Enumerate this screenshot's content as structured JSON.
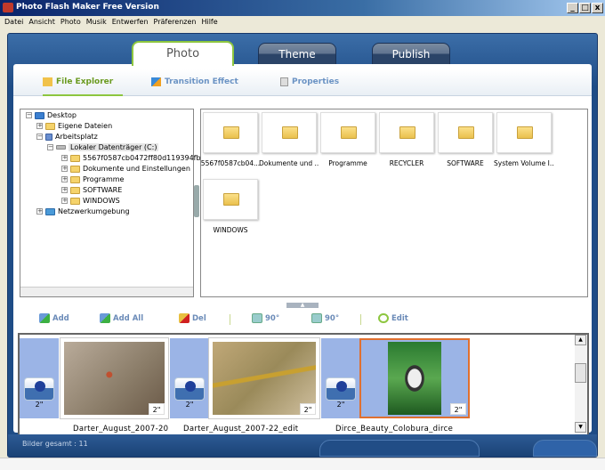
{
  "window": {
    "title": "Photo Flash Maker Free Version",
    "minimize": "_",
    "maximize": "□",
    "close": "x"
  },
  "menu": [
    "Datei",
    "Ansicht",
    "Photo",
    "Musik",
    "Entwerfen",
    "Präferenzen",
    "Hilfe"
  ],
  "main_tabs": [
    "Photo",
    "Theme",
    "Publish"
  ],
  "sub_tabs": [
    "File Explorer",
    "Transition Effect",
    "Properties"
  ],
  "tree": [
    {
      "label": "Desktop",
      "expander": "−"
    },
    {
      "label": "Eigene Dateien",
      "expander": "+"
    },
    {
      "label": "Arbeitsplatz",
      "expander": "−"
    },
    {
      "label": "Lokaler Datenträger (C:)",
      "expander": "−"
    },
    {
      "label": "5567f0587cb0472ff80d119394fb",
      "expander": "+"
    },
    {
      "label": "Dokumente und Einstellungen",
      "expander": "+"
    },
    {
      "label": "Programme",
      "expander": "+"
    },
    {
      "label": "SOFTWARE",
      "expander": "+"
    },
    {
      "label": "WINDOWS",
      "expander": "+"
    },
    {
      "label": "Netzwerkumgebung",
      "expander": "+"
    }
  ],
  "folders": [
    "5567f0587cb04...",
    "Dokumente und ...",
    "Programme",
    "RECYCLER",
    "SOFTWARE",
    "System Volume I...",
    "WINDOWS"
  ],
  "toolbar": {
    "add": "Add",
    "add_all": "Add All",
    "del": "Del",
    "rotate_left": "90°",
    "rotate_right": "90°",
    "edit": "Edit"
  },
  "filmstrip": {
    "transitions": [
      "2\"",
      "2\"",
      "2\""
    ],
    "photos": [
      {
        "name": "Darter_August_2007-20",
        "duration": "2\""
      },
      {
        "name": "Darter_August_2007-22_edit",
        "duration": "2\""
      },
      {
        "name": "Dirce_Beauty_Colobura_dirce",
        "duration": "2\""
      }
    ]
  },
  "status": "Bilder gesamt : 11",
  "colors": {
    "accent_green": "#8dc63f",
    "frame_blue": "#1e4c86",
    "transition_blue": "#9bb4e6",
    "selected_border": "#e07030"
  }
}
